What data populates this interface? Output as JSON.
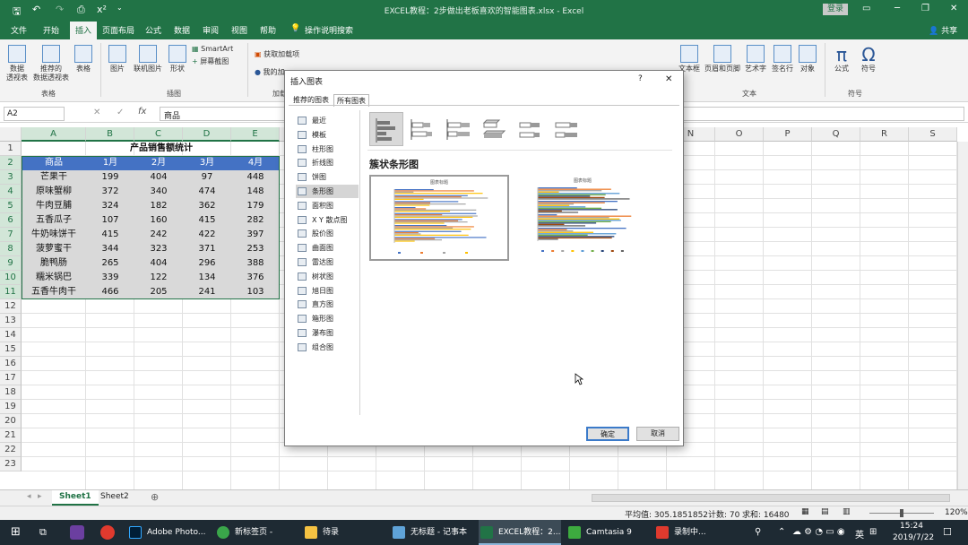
{
  "window": {
    "title": "EXCEL教程：2步做出老板喜欢的智能图表.xlsx  -  Excel",
    "login": "登录",
    "quick_access": [
      "save",
      "undo",
      "redo",
      "preview",
      "superscript",
      "more"
    ]
  },
  "tabs": [
    "文件",
    "开始",
    "插入",
    "页面布局",
    "公式",
    "数据",
    "审阅",
    "视图",
    "帮助"
  ],
  "active_tab": "插入",
  "tell_me": "操作说明搜索",
  "share": "共享",
  "ribbon": {
    "tables": {
      "items": [
        "数据\n透视表",
        "推荐的\n数据透视表",
        "表格"
      ],
      "label": "表格"
    },
    "illustrations": {
      "items": [
        "图片",
        "联机图片",
        "形状"
      ],
      "smartart": "SmartArt",
      "screenshot": "屏幕截图",
      "label": "插图"
    },
    "addins": {
      "get": "获取加载项",
      "my": "我的加",
      "label": "加载"
    },
    "text": {
      "items": [
        "文本框",
        "页眉和页脚",
        "艺术字",
        "签名行",
        "对象"
      ],
      "label": "文本"
    },
    "symbols": {
      "items": [
        "公式",
        "符号"
      ],
      "label": "符号"
    }
  },
  "formula_bar": {
    "name_box": "A2",
    "content": "商品"
  },
  "columns": [
    "A",
    "B",
    "C",
    "D",
    "E",
    "F",
    "G",
    "H",
    "I",
    "J",
    "K",
    "L",
    "M",
    "N",
    "O",
    "P",
    "Q",
    "R",
    "S"
  ],
  "rows": [
    "1",
    "2",
    "3",
    "4",
    "5",
    "6",
    "7",
    "8",
    "9",
    "10",
    "11",
    "12",
    "13",
    "14",
    "15",
    "16",
    "17",
    "18",
    "19",
    "20",
    "21",
    "22",
    "23"
  ],
  "sheet": {
    "title": "产品销售额统计",
    "headers": [
      "商品",
      "1月",
      "2月",
      "3月",
      "4月"
    ],
    "data": [
      [
        "芒果干",
        "199",
        "404",
        "97",
        "448"
      ],
      [
        "原味蟹柳",
        "372",
        "340",
        "474",
        "148"
      ],
      [
        "牛肉豆脯",
        "324",
        "182",
        "362",
        "179"
      ],
      [
        "五香瓜子",
        "107",
        "160",
        "415",
        "282"
      ],
      [
        "牛奶味饼干",
        "415",
        "242",
        "422",
        "397"
      ],
      [
        "菠萝蜜干",
        "344",
        "323",
        "371",
        "253"
      ],
      [
        "脆鸭肠",
        "265",
        "404",
        "296",
        "388"
      ],
      [
        "糯米锅巴",
        "339",
        "122",
        "134",
        "376"
      ],
      [
        "五香牛肉干",
        "466",
        "205",
        "241",
        "103"
      ]
    ]
  },
  "sheets": [
    "Sheet1",
    "Sheet2"
  ],
  "status": {
    "average": "平均值: 305.1851852",
    "count": "计数: 70",
    "sum": "求和: 16480",
    "zoom": "120%"
  },
  "dialog": {
    "title": "插入图表",
    "help": "?",
    "close": "✕",
    "tabs": [
      "推荐的图表",
      "所有图表"
    ],
    "active_tab": "所有图表",
    "categories": [
      "最近",
      "模板",
      "柱形图",
      "折线图",
      "饼图",
      "条形图",
      "面积图",
      "X Y 散点图",
      "股价图",
      "曲面图",
      "雷达图",
      "树状图",
      "旭日图",
      "直方图",
      "箱形图",
      "瀑布图",
      "组合图"
    ],
    "selected_category": "条形图",
    "subtype_name": "簇状条形图",
    "preview_title": "图表标题",
    "ok": "确定",
    "cancel": "取消"
  },
  "taskbar": {
    "apps": [
      "Adobe Photo...",
      "新标签页 - 360...",
      "待录",
      "无标题 - 记事本",
      "EXCEL教程：2...",
      "Camtasia 9",
      "录制中..."
    ],
    "ime": "英",
    "time": "15:24",
    "date": "2019/7/22"
  },
  "colors": {
    "excel_green": "#217346",
    "header_fill": "#4472c4",
    "data_fill": "#d9d9d9"
  }
}
